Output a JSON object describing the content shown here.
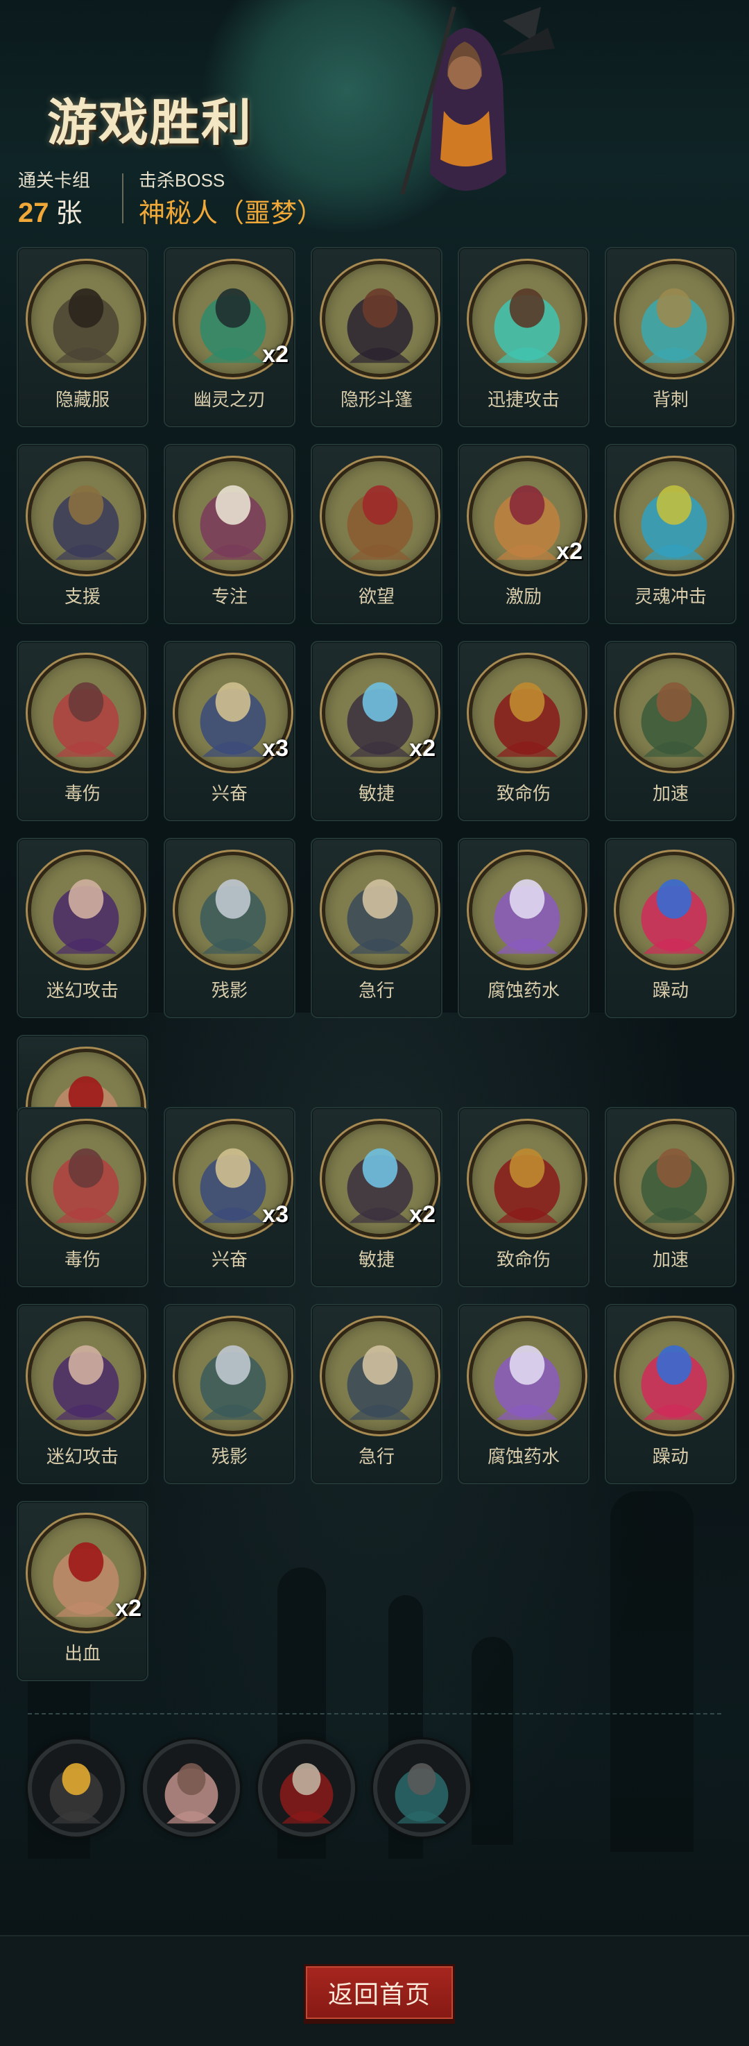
{
  "header": {
    "title": "游戏胜利",
    "stage_label": "通关卡组",
    "stage_count": "27",
    "stage_unit": "张",
    "boss_label": "击杀BOSS",
    "boss_name": "神秘人（噩梦）"
  },
  "cards": [
    {
      "name": "隐藏服",
      "count": "",
      "icon": "hood-cloak-icon"
    },
    {
      "name": "幽灵之刃",
      "count": "x2",
      "icon": "ghost-blade-icon"
    },
    {
      "name": "隐形斗篷",
      "count": "",
      "icon": "invisibility-cape-icon"
    },
    {
      "name": "迅捷攻击",
      "count": "",
      "icon": "swift-attack-icon"
    },
    {
      "name": "背刺",
      "count": "",
      "icon": "backstab-icon"
    },
    {
      "name": "支援",
      "count": "",
      "icon": "support-icon"
    },
    {
      "name": "专注",
      "count": "",
      "icon": "focus-icon"
    },
    {
      "name": "欲望",
      "count": "",
      "icon": "greed-icon"
    },
    {
      "name": "激励",
      "count": "x2",
      "icon": "inspire-icon"
    },
    {
      "name": "灵魂冲击",
      "count": "",
      "icon": "soul-strike-icon"
    },
    {
      "name": "毒伤",
      "count": "",
      "icon": "poison-icon"
    },
    {
      "name": "兴奋",
      "count": "x3",
      "icon": "excite-icon"
    },
    {
      "name": "敏捷",
      "count": "x2",
      "icon": "agility-icon"
    },
    {
      "name": "致命伤",
      "count": "",
      "icon": "fatal-wound-icon"
    },
    {
      "name": "加速",
      "count": "",
      "icon": "haste-icon"
    },
    {
      "name": "迷幻攻击",
      "count": "",
      "icon": "illusion-attack-icon"
    },
    {
      "name": "残影",
      "count": "",
      "icon": "afterimage-icon"
    },
    {
      "name": "急行",
      "count": "",
      "icon": "dash-icon"
    },
    {
      "name": "腐蚀药水",
      "count": "",
      "icon": "corrosive-potion-icon"
    },
    {
      "name": "躁动",
      "count": "",
      "icon": "frenzy-icon"
    },
    {
      "name": "出血",
      "count": "",
      "icon": "bleed-icon"
    },
    {
      "name": "毒伤",
      "count": "",
      "icon": "poison-icon"
    },
    {
      "name": "兴奋",
      "count": "x3",
      "icon": "excite-icon"
    },
    {
      "name": "敏捷",
      "count": "x2",
      "icon": "agility-icon"
    },
    {
      "name": "致命伤",
      "count": "",
      "icon": "fatal-wound-icon"
    },
    {
      "name": "加速",
      "count": "",
      "icon": "haste-icon"
    },
    {
      "name": "迷幻攻击",
      "count": "",
      "icon": "illusion-attack-icon"
    },
    {
      "name": "残影",
      "count": "",
      "icon": "afterimage-icon"
    },
    {
      "name": "急行",
      "count": "",
      "icon": "dash-icon"
    },
    {
      "name": "腐蚀药水",
      "count": "",
      "icon": "corrosive-potion-icon"
    },
    {
      "name": "躁动",
      "count": "",
      "icon": "frenzy-icon"
    },
    {
      "name": "出血",
      "count": "x2",
      "icon": "bleed-icon"
    }
  ],
  "relics": [
    {
      "icon": "gold-pot-icon"
    },
    {
      "icon": "pig-icon"
    },
    {
      "icon": "crossbow-icon"
    },
    {
      "icon": "dark-altar-icon"
    }
  ],
  "footer": {
    "home_button": "返回首页"
  },
  "colors": {
    "accent_gold": "#f0a838",
    "button_red": "#a7261f",
    "card_art_bg": "#7f7d4d"
  }
}
